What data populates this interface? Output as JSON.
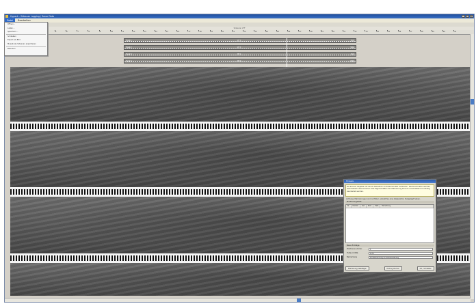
{
  "window": {
    "title": "Hypack - Sidescan Logging / Sonar Data",
    "controls": [
      "_",
      "□",
      "×"
    ]
  },
  "menubar": {
    "items": [
      "Datei",
      "Bearbeiten"
    ],
    "active_index": 0
  },
  "dropdown": {
    "items": [
      "Öffnen...",
      "Laden...",
      "Speichern...",
      "Schließen",
      "Export als Bild",
      "Mosaik als Sidescan exportieren",
      "Beenden"
    ]
  },
  "ruler": {
    "header": "Sidescan LFF",
    "ticks": [
      "1",
      "2",
      "3",
      "4",
      "5",
      "6",
      "7",
      "8",
      "9",
      "10",
      "11",
      "12",
      "13",
      "14",
      "15",
      "16",
      "17",
      "18",
      "19",
      "20",
      "21",
      "22",
      "23",
      "24",
      "25",
      "26",
      "27",
      "28",
      "29",
      "30",
      "31",
      "32",
      "33",
      "34",
      "35",
      "36",
      "37",
      "38",
      "39",
      "40",
      "41"
    ]
  },
  "tracks": [
    {
      "left": "Track 1",
      "mid": "LF 1",
      "right": "Port"
    },
    {
      "left": "Track 2",
      "mid": "LF 2",
      "right": "Stbd"
    },
    {
      "left": "Track 3",
      "mid": "HF 1",
      "right": "Port"
    },
    {
      "left": "Track 4",
      "mid": "HF 2",
      "right": "Stbd"
    }
  ],
  "dialog": {
    "title": "Hinweis",
    "message": "Sie können Objekte mit einem Mausklick im Sidescan-Bild markieren. Die Koordinaten werden automatisch übernommen. Die Eigenschaften der Markierung können anschließend im Dialog bearbeitet werden.",
    "hint": "Achtung: Markierungen sind sichtbar, sobald Sie eine Zielposition festgelegt haben.",
    "group_label": "Markierungsliste",
    "columns": [
      "Nr",
      "Position",
      "Ost",
      "Nord",
      "Tiefe",
      "Bemerkung"
    ],
    "fields_header": "Neue Einträge",
    "fields": [
      {
        "label": "Positionsnummer",
        "value": "1"
      },
      {
        "label": "Tiefe (m NN)",
        "value": "4,76"
      },
      {
        "label": "Bemerkung",
        "value": "Sonderkennung an Schienenstrang"
      }
    ],
    "buttons": {
      "left": "Markierung bestätigen",
      "mid": "Eintrag löschen",
      "right": "OK / Schließen"
    }
  }
}
